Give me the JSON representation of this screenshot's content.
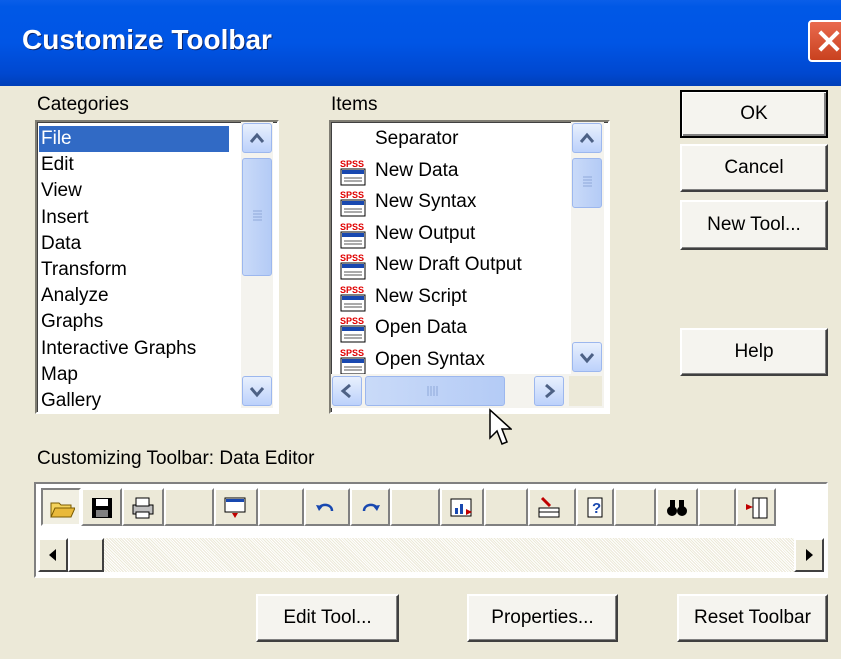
{
  "window": {
    "title": "Customize Toolbar",
    "close_icon": "close-icon"
  },
  "categories": {
    "label": "Categories",
    "items": [
      "File",
      "Edit",
      "View",
      "Insert",
      "Data",
      "Transform",
      "Analyze",
      "Graphs",
      "Interactive Graphs",
      "Map",
      "Gallery"
    ],
    "selected": "File"
  },
  "items_list": {
    "label": "Items",
    "items": [
      {
        "label": "Separator",
        "icon": "none"
      },
      {
        "label": "New Data",
        "icon": "spss-new-data-icon"
      },
      {
        "label": "New Syntax",
        "icon": "spss-new-syntax-icon"
      },
      {
        "label": "New Output",
        "icon": "spss-new-output-icon"
      },
      {
        "label": "New Draft Output",
        "icon": "spss-new-draft-output-icon"
      },
      {
        "label": "New Script",
        "icon": "spss-new-script-icon"
      },
      {
        "label": "Open Data",
        "icon": "spss-open-data-icon"
      },
      {
        "label": "Open Syntax",
        "icon": "spss-open-syntax-icon"
      }
    ]
  },
  "buttons": {
    "ok": "OK",
    "cancel": "Cancel",
    "new_tool": "New Tool...",
    "help": "Help",
    "edit_tool": "Edit Tool...",
    "properties": "Properties...",
    "reset_toolbar": "Reset Toolbar"
  },
  "customizing_label": "Customizing Toolbar: Data Editor",
  "toolbar_icons": [
    "open-folder-icon",
    "save-icon",
    "print-icon",
    "blank",
    "dialog-recall-icon",
    "blank",
    "undo-icon",
    "redo-icon",
    "blank",
    "goto-chart-icon",
    "blank",
    "insert-case-icon",
    "variables-icon",
    "blank",
    "find-binoculars-icon",
    "blank",
    "insert-variable-icon"
  ],
  "colors": {
    "title_bar": "#0055e5",
    "selection": "#316ac5",
    "dialog_bg": "#ece9d8"
  }
}
